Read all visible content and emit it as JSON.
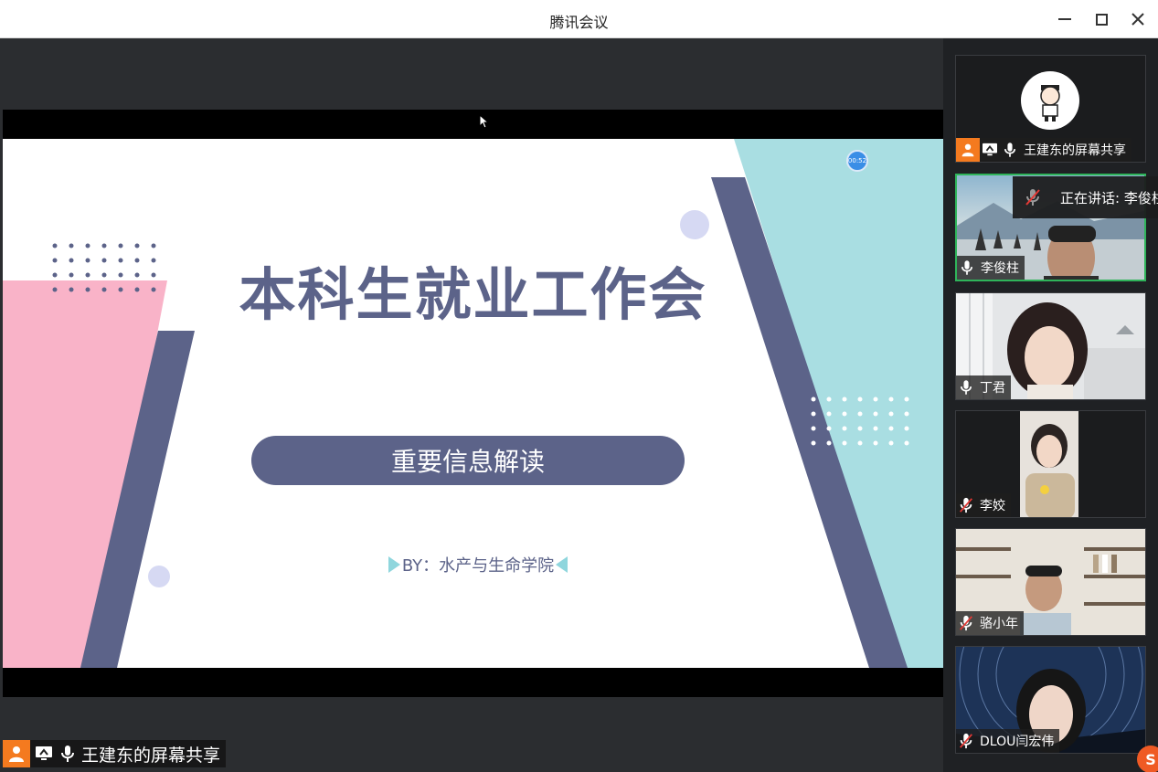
{
  "window": {
    "title": "腾讯会议"
  },
  "slide": {
    "title": "本科生就业工作会",
    "subtitle": "重要信息解读",
    "byline": "BY：水产与生命学院",
    "timer_badge": "00:52"
  },
  "share": {
    "label": "王建东的屏幕共享"
  },
  "speaking": {
    "text": "正在讲话: 李俊柱"
  },
  "participants": [
    {
      "name": "王建东的屏幕共享",
      "mic": "on",
      "kind": "host-share"
    },
    {
      "name": "李俊柱",
      "mic": "on",
      "kind": "video"
    },
    {
      "name": "丁君",
      "mic": "on",
      "kind": "video"
    },
    {
      "name": "李姣",
      "mic": "muted",
      "kind": "video"
    },
    {
      "name": "骆小年",
      "mic": "muted",
      "kind": "video"
    },
    {
      "name": "DLOU闫宏伟",
      "mic": "muted",
      "kind": "video"
    }
  ],
  "colors": {
    "accent_orange": "#f47a1f",
    "slide_navy": "#5c6389",
    "slide_pink": "#f9b3c8",
    "slide_teal": "#a9dee2",
    "active_border": "#2fb45a"
  }
}
